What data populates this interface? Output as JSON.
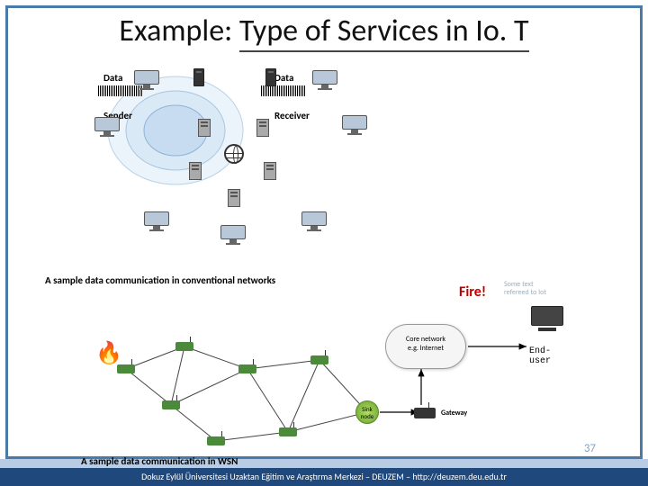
{
  "title_parts": {
    "prefix": "Example: ",
    "underlined": "Type of Services in Io. T"
  },
  "labels": {
    "data1": "Data",
    "data2": "Data",
    "sender": "Sender",
    "receiver": "Receiver"
  },
  "captions": {
    "conventional": "A sample data communication in conventional networks",
    "wsn": "A sample data communication in WSN"
  },
  "wsn": {
    "cloud": "Core network\ne.g. Internet",
    "sink": "Sink\nnode",
    "gateway": "Gateway",
    "fire_alert": "Fire!",
    "enduser": "End-user"
  },
  "extra_text": "Some text\nrefereed to Iot",
  "page_number": "37",
  "footer": "Dokuz Eylül Üniversitesi Uzaktan Eğitim ve Araştırma Merkezi – DEUZEM – http://deuzem.deu.edu.tr"
}
